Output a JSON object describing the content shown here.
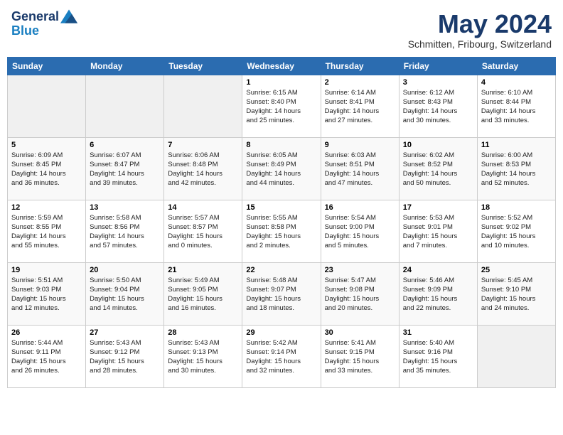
{
  "header": {
    "logo_line1": "General",
    "logo_line2": "Blue",
    "title": "May 2024",
    "subtitle": "Schmitten, Fribourg, Switzerland"
  },
  "weekdays": [
    "Sunday",
    "Monday",
    "Tuesday",
    "Wednesday",
    "Thursday",
    "Friday",
    "Saturday"
  ],
  "weeks": [
    [
      {
        "day": "",
        "info": ""
      },
      {
        "day": "",
        "info": ""
      },
      {
        "day": "",
        "info": ""
      },
      {
        "day": "1",
        "info": "Sunrise: 6:15 AM\nSunset: 8:40 PM\nDaylight: 14 hours\nand 25 minutes."
      },
      {
        "day": "2",
        "info": "Sunrise: 6:14 AM\nSunset: 8:41 PM\nDaylight: 14 hours\nand 27 minutes."
      },
      {
        "day": "3",
        "info": "Sunrise: 6:12 AM\nSunset: 8:43 PM\nDaylight: 14 hours\nand 30 minutes."
      },
      {
        "day": "4",
        "info": "Sunrise: 6:10 AM\nSunset: 8:44 PM\nDaylight: 14 hours\nand 33 minutes."
      }
    ],
    [
      {
        "day": "5",
        "info": "Sunrise: 6:09 AM\nSunset: 8:45 PM\nDaylight: 14 hours\nand 36 minutes."
      },
      {
        "day": "6",
        "info": "Sunrise: 6:07 AM\nSunset: 8:47 PM\nDaylight: 14 hours\nand 39 minutes."
      },
      {
        "day": "7",
        "info": "Sunrise: 6:06 AM\nSunset: 8:48 PM\nDaylight: 14 hours\nand 42 minutes."
      },
      {
        "day": "8",
        "info": "Sunrise: 6:05 AM\nSunset: 8:49 PM\nDaylight: 14 hours\nand 44 minutes."
      },
      {
        "day": "9",
        "info": "Sunrise: 6:03 AM\nSunset: 8:51 PM\nDaylight: 14 hours\nand 47 minutes."
      },
      {
        "day": "10",
        "info": "Sunrise: 6:02 AM\nSunset: 8:52 PM\nDaylight: 14 hours\nand 50 minutes."
      },
      {
        "day": "11",
        "info": "Sunrise: 6:00 AM\nSunset: 8:53 PM\nDaylight: 14 hours\nand 52 minutes."
      }
    ],
    [
      {
        "day": "12",
        "info": "Sunrise: 5:59 AM\nSunset: 8:55 PM\nDaylight: 14 hours\nand 55 minutes."
      },
      {
        "day": "13",
        "info": "Sunrise: 5:58 AM\nSunset: 8:56 PM\nDaylight: 14 hours\nand 57 minutes."
      },
      {
        "day": "14",
        "info": "Sunrise: 5:57 AM\nSunset: 8:57 PM\nDaylight: 15 hours\nand 0 minutes."
      },
      {
        "day": "15",
        "info": "Sunrise: 5:55 AM\nSunset: 8:58 PM\nDaylight: 15 hours\nand 2 minutes."
      },
      {
        "day": "16",
        "info": "Sunrise: 5:54 AM\nSunset: 9:00 PM\nDaylight: 15 hours\nand 5 minutes."
      },
      {
        "day": "17",
        "info": "Sunrise: 5:53 AM\nSunset: 9:01 PM\nDaylight: 15 hours\nand 7 minutes."
      },
      {
        "day": "18",
        "info": "Sunrise: 5:52 AM\nSunset: 9:02 PM\nDaylight: 15 hours\nand 10 minutes."
      }
    ],
    [
      {
        "day": "19",
        "info": "Sunrise: 5:51 AM\nSunset: 9:03 PM\nDaylight: 15 hours\nand 12 minutes."
      },
      {
        "day": "20",
        "info": "Sunrise: 5:50 AM\nSunset: 9:04 PM\nDaylight: 15 hours\nand 14 minutes."
      },
      {
        "day": "21",
        "info": "Sunrise: 5:49 AM\nSunset: 9:05 PM\nDaylight: 15 hours\nand 16 minutes."
      },
      {
        "day": "22",
        "info": "Sunrise: 5:48 AM\nSunset: 9:07 PM\nDaylight: 15 hours\nand 18 minutes."
      },
      {
        "day": "23",
        "info": "Sunrise: 5:47 AM\nSunset: 9:08 PM\nDaylight: 15 hours\nand 20 minutes."
      },
      {
        "day": "24",
        "info": "Sunrise: 5:46 AM\nSunset: 9:09 PM\nDaylight: 15 hours\nand 22 minutes."
      },
      {
        "day": "25",
        "info": "Sunrise: 5:45 AM\nSunset: 9:10 PM\nDaylight: 15 hours\nand 24 minutes."
      }
    ],
    [
      {
        "day": "26",
        "info": "Sunrise: 5:44 AM\nSunset: 9:11 PM\nDaylight: 15 hours\nand 26 minutes."
      },
      {
        "day": "27",
        "info": "Sunrise: 5:43 AM\nSunset: 9:12 PM\nDaylight: 15 hours\nand 28 minutes."
      },
      {
        "day": "28",
        "info": "Sunrise: 5:43 AM\nSunset: 9:13 PM\nDaylight: 15 hours\nand 30 minutes."
      },
      {
        "day": "29",
        "info": "Sunrise: 5:42 AM\nSunset: 9:14 PM\nDaylight: 15 hours\nand 32 minutes."
      },
      {
        "day": "30",
        "info": "Sunrise: 5:41 AM\nSunset: 9:15 PM\nDaylight: 15 hours\nand 33 minutes."
      },
      {
        "day": "31",
        "info": "Sunrise: 5:40 AM\nSunset: 9:16 PM\nDaylight: 15 hours\nand 35 minutes."
      },
      {
        "day": "",
        "info": ""
      }
    ]
  ]
}
